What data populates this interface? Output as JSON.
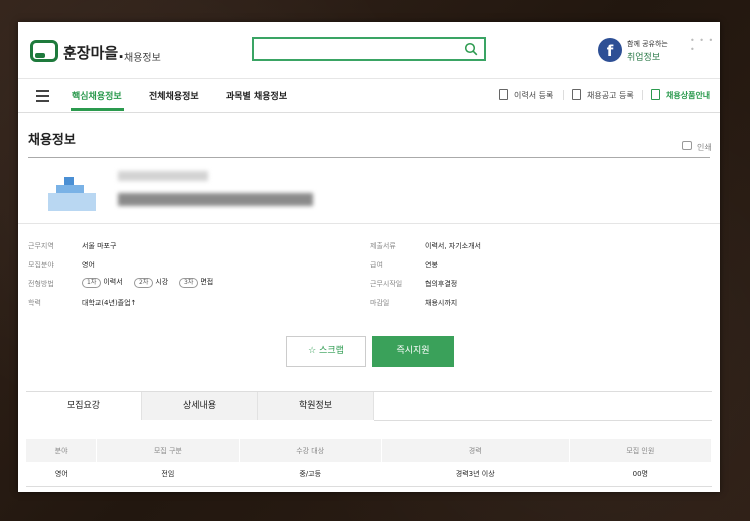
{
  "header": {
    "logo_text": "훈장마을.",
    "logo_sub": "채용정보",
    "search_value": "",
    "share_line1": "함께 공유하는",
    "share_line2": "취업정보",
    "fb_letter": "f"
  },
  "nav": {
    "tabs": [
      {
        "label": "핵심채용정보",
        "active": true
      },
      {
        "label": "전체채용정보",
        "active": false
      },
      {
        "label": "과목별 채용정보",
        "active": false
      }
    ],
    "right": [
      {
        "label": "이력서 등록"
      },
      {
        "label": "채용공고 등록"
      },
      {
        "label": "채용상품안내"
      }
    ]
  },
  "page": {
    "title": "채용정보",
    "print_label": "인쇄"
  },
  "info": {
    "left": [
      {
        "label": "근무지역",
        "value": "서울 마포구"
      },
      {
        "label": "모집분야",
        "value": "영어"
      },
      {
        "label": "전형방법",
        "value": ""
      },
      {
        "label": "학력",
        "value": "대학교(4년)졸업↑"
      }
    ],
    "steps": [
      {
        "badge": "1차",
        "text": "이력서"
      },
      {
        "badge": "2차",
        "text": "시강"
      },
      {
        "badge": "3차",
        "text": "면접"
      }
    ],
    "right": [
      {
        "label": "제출서류",
        "value": "이력서, 자기소개서"
      },
      {
        "label": "급여",
        "value": "연봉"
      },
      {
        "label": "근무시작일",
        "value": "협의후결정"
      },
      {
        "label": "마감일",
        "value": "채용시까지"
      }
    ]
  },
  "actions": {
    "scrap_label": "스크랩",
    "apply_label": "즉시지원"
  },
  "tabs": [
    {
      "label": "모집요강",
      "active": true
    },
    {
      "label": "상세내용",
      "active": false
    },
    {
      "label": "학원정보",
      "active": false
    }
  ],
  "table": {
    "headers": [
      "분야",
      "모집 구분",
      "수강 대상",
      "경력",
      "모집 인원"
    ],
    "rows": [
      [
        "영어",
        "전임",
        "중/고등",
        "경력3년 이상",
        "00명"
      ]
    ]
  },
  "colors": {
    "brand_green": "#2b9a4e",
    "facebook_blue": "#2d4f95"
  }
}
